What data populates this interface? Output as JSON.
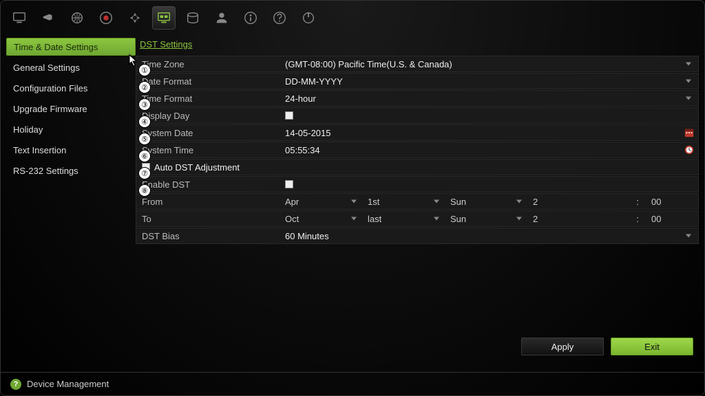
{
  "sidebar": {
    "items": [
      {
        "label": "Time & Date Settings"
      },
      {
        "label": "General Settings"
      },
      {
        "label": "Configuration Files"
      },
      {
        "label": "Upgrade Firmware"
      },
      {
        "label": "Holiday"
      },
      {
        "label": "Text Insertion"
      },
      {
        "label": "RS-232 Settings"
      }
    ]
  },
  "tabs": {
    "active": "DST Settings"
  },
  "fields": {
    "time_zone_label": "Time Zone",
    "time_zone_value": "(GMT-08:00) Pacific Time(U.S. & Canada)",
    "date_format_label": "Date Format",
    "date_format_value": "DD-MM-YYYY",
    "time_format_label": "Time Format",
    "time_format_value": "24-hour",
    "display_day_label": "Display Day",
    "system_date_label": "System Date",
    "system_date_value": "14-05-2015",
    "system_time_label": "System Time",
    "system_time_value": "05:55:34",
    "auto_dst_label": "Auto DST Adjustment",
    "enable_dst_label": "Enable DST",
    "from_label": "From",
    "from": {
      "month": "Apr",
      "week": "1st",
      "day": "Sun",
      "hour": "2",
      "min": "00"
    },
    "to_label": "To",
    "to": {
      "month": "Oct",
      "week": "last",
      "day": "Sun",
      "hour": "2",
      "min": "00"
    },
    "dst_bias_label": "DST Bias",
    "dst_bias_value": "60 Minutes"
  },
  "buttons": {
    "apply": "Apply",
    "exit": "Exit"
  },
  "footer": {
    "title": "Device Management"
  },
  "callouts": [
    "①",
    "②",
    "③",
    "④",
    "⑤",
    "⑥",
    "⑦",
    "⑧"
  ],
  "colon": ":"
}
